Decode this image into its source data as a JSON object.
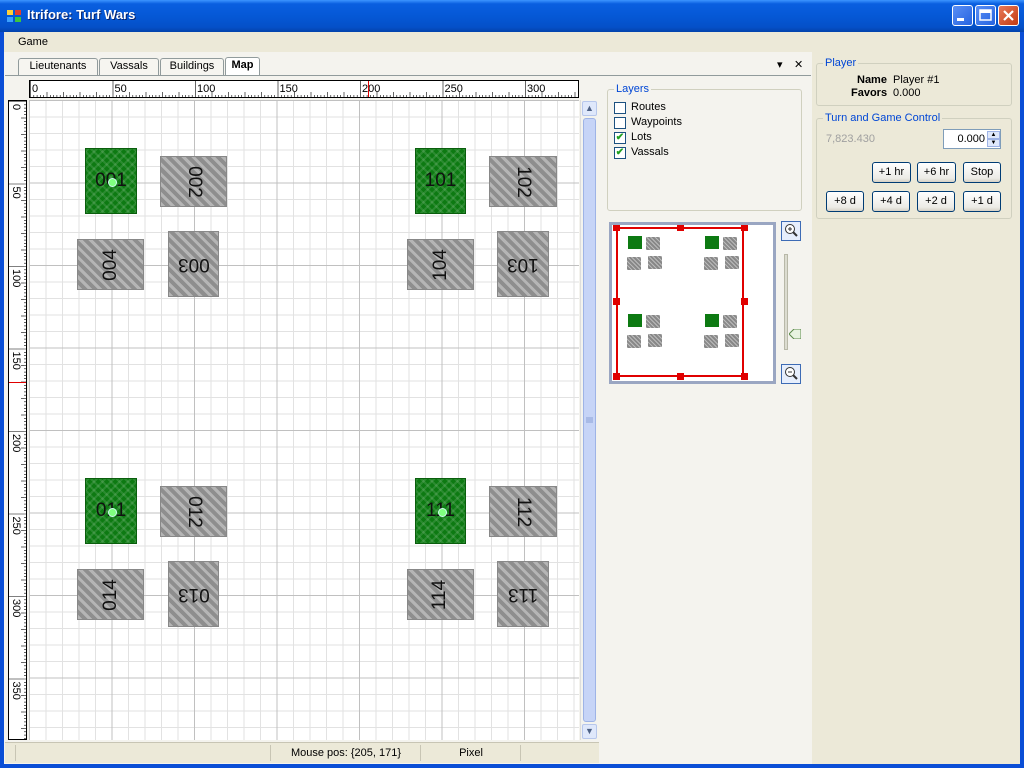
{
  "window": {
    "title": "Itrifore: Turf Wars"
  },
  "menu": {
    "game": "Game"
  },
  "tabs": [
    "Lieutenants",
    "Vassals",
    "Buildings",
    "Map"
  ],
  "tab_controls": {
    "dropdown": "▾",
    "close": "✕"
  },
  "ruler": {
    "top_labels": [
      "0",
      "50",
      "100",
      "150",
      "200",
      "250",
      "300"
    ],
    "left_labels": [
      "0",
      "50",
      "100",
      "150",
      "200",
      "250",
      "300",
      "350"
    ]
  },
  "lots": [
    {
      "label": "001",
      "color": "green",
      "vassal": true
    },
    {
      "label": "002",
      "color": "gray"
    },
    {
      "label": "003",
      "color": "gray"
    },
    {
      "label": "004",
      "color": "gray"
    },
    {
      "label": "101",
      "color": "green"
    },
    {
      "label": "102",
      "color": "gray"
    },
    {
      "label": "103",
      "color": "gray"
    },
    {
      "label": "104",
      "color": "gray"
    },
    {
      "label": "011",
      "color": "green",
      "vassal": true
    },
    {
      "label": "012",
      "color": "gray"
    },
    {
      "label": "013",
      "color": "gray"
    },
    {
      "label": "014",
      "color": "gray"
    },
    {
      "label": "111",
      "color": "green",
      "vassal": true
    },
    {
      "label": "112",
      "color": "gray"
    },
    {
      "label": "113",
      "color": "gray"
    },
    {
      "label": "114",
      "color": "gray"
    }
  ],
  "status": {
    "mouse_pos": "Mouse pos: {205, 171}",
    "unit": "Pixel"
  },
  "layers": {
    "title": "Layers",
    "items": [
      {
        "label": "Routes",
        "checked": false
      },
      {
        "label": "Waypoints",
        "checked": false
      },
      {
        "label": "Lots",
        "checked": true
      },
      {
        "label": "Vassals",
        "checked": true
      }
    ]
  },
  "player": {
    "title": "Player",
    "name_label": "Name",
    "name_value": "Player #1",
    "favors_label": "Favors",
    "favors_value": "0.000"
  },
  "turn": {
    "title": "Turn and Game Control",
    "time_value": "7,823.430",
    "spin_value": "0.000",
    "buttons_row1": [
      "+1 hr",
      "+6 hr",
      "Stop"
    ],
    "buttons_row2": [
      "+8 d",
      "+4 d",
      "+2 d",
      "+1 d"
    ]
  },
  "colors": {
    "lot_green": "#0d7a12",
    "lot_gray": "#999999",
    "title_blue": "#0558d6",
    "group_title": "#0046d5"
  }
}
